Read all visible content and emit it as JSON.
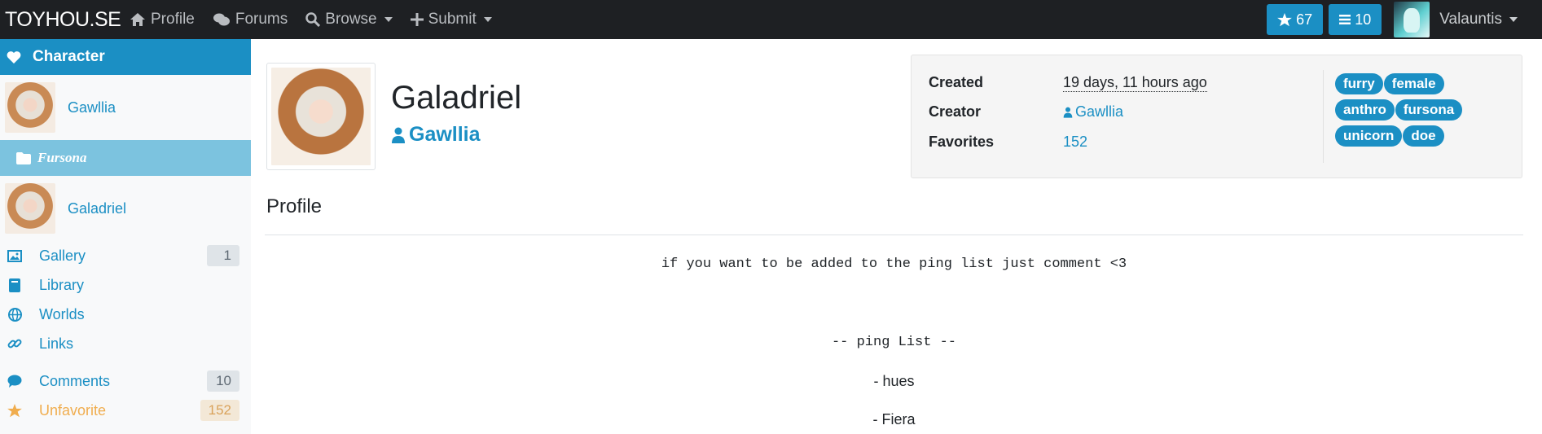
{
  "navbar": {
    "brand": "TOYHOU.SE",
    "items": [
      {
        "label": "Profile",
        "icon": "home-icon"
      },
      {
        "label": "Forums",
        "icon": "comments-icon"
      },
      {
        "label": "Browse",
        "icon": "search-icon"
      },
      {
        "label": "Submit",
        "icon": "plus-icon"
      }
    ],
    "star_count": "67",
    "list_count": "10",
    "username": "Valauntis"
  },
  "sidebar": {
    "header": "Character",
    "owner": "Gawllia",
    "folder": "Fursona",
    "character": "Galadriel",
    "links": [
      {
        "label": "Gallery",
        "count": "1",
        "icon": "image-icon"
      },
      {
        "label": "Library",
        "count": "",
        "icon": "book-icon"
      },
      {
        "label": "Worlds",
        "count": "",
        "icon": "globe-icon"
      },
      {
        "label": "Links",
        "count": "",
        "icon": "link-icon"
      },
      {
        "label": "Comments",
        "count": "10",
        "icon": "comment-icon"
      },
      {
        "label": "Unfavorite",
        "count": "152",
        "icon": "star-icon"
      }
    ]
  },
  "character": {
    "name": "Galadriel",
    "creator": "Gawllia"
  },
  "info": {
    "created_label": "Created",
    "created_value": "19 days, 11 hours ago",
    "creator_label": "Creator",
    "creator_value": "Gawllia",
    "favorites_label": "Favorites",
    "favorites_value": "152",
    "tags": [
      [
        "furry",
        "female"
      ],
      [
        "anthro",
        "fursona"
      ],
      [
        "unicorn",
        "doe"
      ]
    ]
  },
  "profile": {
    "title": "Profile",
    "line1": "if you want to be added to the ping list just comment <3",
    "line2": "-- ping List --",
    "line3": "- hues",
    "line4": "- Fiera"
  },
  "colors": {
    "accent": "#1b8fc4",
    "navbar": "#1e2023",
    "folder": "#7cc3df",
    "favorite": "#f0ad4e"
  }
}
